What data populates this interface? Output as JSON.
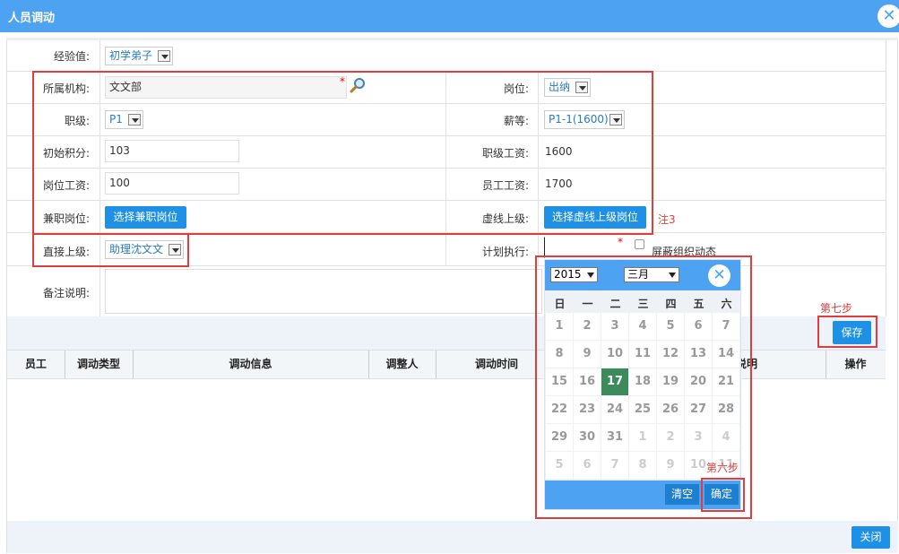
{
  "window": {
    "title": "人员调动",
    "close_symbol": "✕"
  },
  "form": {
    "experience": {
      "label": "经验值:",
      "value": "初学弟子"
    },
    "org": {
      "label": "所属机构:",
      "value": "文文部",
      "required": "*"
    },
    "position": {
      "label": "岗位:",
      "value": "出纳"
    },
    "rank": {
      "label": "职级:",
      "value": "P1"
    },
    "salary_grade": {
      "label": "薪等:",
      "value": "P1-1(1600)"
    },
    "initial_points": {
      "label": "初始积分:",
      "value": "103"
    },
    "rank_salary": {
      "label": "职级工资:",
      "value": "1600"
    },
    "position_salary": {
      "label": "岗位工资:",
      "value": "100"
    },
    "employee_salary": {
      "label": "员工工资:",
      "value": "1700"
    },
    "part_time": {
      "label": "兼职岗位:",
      "button": "选择兼职岗位"
    },
    "dotted_superior": {
      "label": "虚线上级:",
      "button": "选择虚线上级岗位"
    },
    "direct_superior": {
      "label": "直接上级:",
      "value": "助理沈文文"
    },
    "plan_exec": {
      "label": "计划执行:",
      "value": "",
      "required": "*"
    },
    "mask_checkbox": {
      "label": "屏蔽组织动态",
      "checked": false
    },
    "remark": {
      "label": "备注说明:",
      "value": ""
    }
  },
  "save_button": "保存",
  "close_button": "关闭",
  "table": {
    "headers": [
      "员工",
      "调动类型",
      "调动信息",
      "调整人",
      "调动时间",
      "说明",
      "操作"
    ],
    "rows": []
  },
  "annotations": {
    "note3": "注3",
    "step6": "第六步",
    "step7": "第七步"
  },
  "calendar": {
    "year": "2015",
    "month": "三月",
    "weekdays": [
      "日",
      "一",
      "二",
      "三",
      "四",
      "五",
      "六"
    ],
    "weeks": [
      [
        "1",
        "2",
        "3",
        "4",
        "5",
        "6",
        "7"
      ],
      [
        "8",
        "9",
        "10",
        "11",
        "12",
        "13",
        "14"
      ],
      [
        "15",
        "16",
        "17",
        "18",
        "19",
        "20",
        "21"
      ],
      [
        "22",
        "23",
        "24",
        "25",
        "26",
        "27",
        "28"
      ],
      [
        "29",
        "30",
        "31",
        "1",
        "2",
        "3",
        "4"
      ],
      [
        "5",
        "6",
        "7",
        "8",
        "9",
        "10",
        "11"
      ]
    ],
    "today": "17",
    "clear_button": "清空",
    "confirm_button": "确定"
  },
  "colors": {
    "titlebar": "#4ea2f2",
    "button": "#1e90e6",
    "annotation": "#e23d3d",
    "today": "#3d8a5a"
  }
}
